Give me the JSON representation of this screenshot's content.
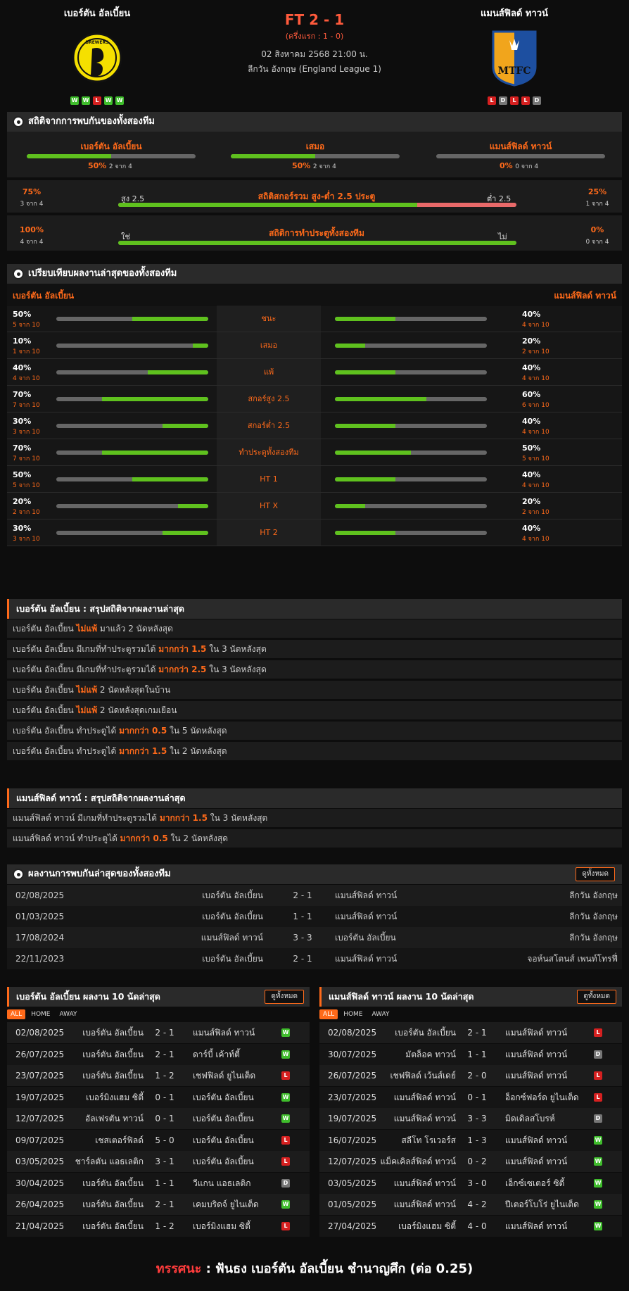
{
  "match": {
    "home": "เบอร์ตัน อัลเบี้ยน",
    "away": "แมนส์ฟิลด์ ทาวน์",
    "score": "FT 2 - 1",
    "halftime": "(ครึ่งแรก : 1 - 0)",
    "datetime": "02 สิงหาคม 2568 21:00 น.",
    "league": "ลีกวัน อังกฤษ (England League 1)",
    "home_form": [
      "W",
      "W",
      "L",
      "W",
      "W"
    ],
    "away_form": [
      "L",
      "D",
      "L",
      "L",
      "D"
    ],
    "home_logo_text": "BREWERS",
    "away_logo_text": "MTFC"
  },
  "h2h_stats": {
    "title": "สถิติจากการพบกันของทั้งสองทีม",
    "home": {
      "label": "เบอร์ตัน อัลเบี้ยน",
      "pct": "50%",
      "of": "2 จาก 4",
      "value": 0.5
    },
    "draw": {
      "label": "เสมอ",
      "pct": "50%",
      "of": "2 จาก 4",
      "value": 0.5
    },
    "away": {
      "label": "แมนส์ฟิลด์ ทาวน์",
      "pct": "0%",
      "of": "0 จาก 4",
      "value": 0
    },
    "ou": {
      "title": "สถิติสกอร์รวม สูง-ต่ำ 2.5 ประตู",
      "left_pct": "75%",
      "left_of": "3 จาก 4",
      "right_pct": "25%",
      "right_of": "1 จาก 4",
      "left_label": "สูง 2.5",
      "right_label": "ต่ำ 2.5",
      "value": 0.75
    },
    "btts": {
      "title": "สถิติการทำประตูทั้งสองทีม",
      "left_pct": "100%",
      "left_of": "4 จาก 4",
      "right_pct": "0%",
      "right_of": "0 จาก 4",
      "left_label": "ใช่",
      "right_label": "ไม่",
      "value": 1.0
    }
  },
  "compare": {
    "title": "เปรียบเทียบผลงานล่าสุดของทั้งสองทีม",
    "home": "เบอร์ตัน อัลเบี้ยน",
    "away": "แมนส์ฟิลด์ ทาวน์",
    "rows": [
      {
        "label": "ชนะ",
        "hp": "50%",
        "hc": "5 จาก 10",
        "hv": 0.5,
        "ap": "40%",
        "ac": "4 จาก 10",
        "av": 0.4
      },
      {
        "label": "เสมอ",
        "hp": "10%",
        "hc": "1 จาก 10",
        "hv": 0.1,
        "ap": "20%",
        "ac": "2 จาก 10",
        "av": 0.2
      },
      {
        "label": "แพ้",
        "hp": "40%",
        "hc": "4 จาก 10",
        "hv": 0.4,
        "ap": "40%",
        "ac": "4 จาก 10",
        "av": 0.4
      },
      {
        "label": "สกอร์สูง 2.5",
        "hp": "70%",
        "hc": "7 จาก 10",
        "hv": 0.7,
        "ap": "60%",
        "ac": "6 จาก 10",
        "av": 0.6
      },
      {
        "label": "สกอร์ต่ำ 2.5",
        "hp": "30%",
        "hc": "3 จาก 10",
        "hv": 0.3,
        "ap": "40%",
        "ac": "4 จาก 10",
        "av": 0.4
      },
      {
        "label": "ทำประตูทั้งสองทีม",
        "hp": "70%",
        "hc": "7 จาก 10",
        "hv": 0.7,
        "ap": "50%",
        "ac": "5 จาก 10",
        "av": 0.5
      },
      {
        "label": "HT 1",
        "hp": "50%",
        "hc": "5 จาก 10",
        "hv": 0.5,
        "ap": "40%",
        "ac": "4 จาก 10",
        "av": 0.4
      },
      {
        "label": "HT X",
        "hp": "20%",
        "hc": "2 จาก 10",
        "hv": 0.2,
        "ap": "20%",
        "ac": "2 จาก 10",
        "av": 0.2
      },
      {
        "label": "HT 2",
        "hp": "30%",
        "hc": "3 จาก 10",
        "hv": 0.3,
        "ap": "40%",
        "ac": "4 จาก 10",
        "av": 0.4
      }
    ]
  },
  "home_summary": {
    "title": "เบอร์ตัน อัลเบี้ยน : สรุปสถิติจากผลงานล่าสุด",
    "rows": [
      [
        "เบอร์ตัน อัลเบี้ยน ",
        "ไม่แพ้",
        " มาแล้ว 2 นัดหลังสุด"
      ],
      [
        "เบอร์ตัน อัลเบี้ยน มีเกมที่ทำประตูรวมได้ ",
        "มากกว่า 1.5",
        " ใน 3 นัดหลังสุด"
      ],
      [
        "เบอร์ตัน อัลเบี้ยน มีเกมที่ทำประตูรวมได้ ",
        "มากกว่า 2.5",
        " ใน 3 นัดหลังสุด"
      ],
      [
        "เบอร์ตัน อัลเบี้ยน ",
        "ไม่แพ้",
        " 2 นัดหลังสุดในบ้าน"
      ],
      [
        "เบอร์ตัน อัลเบี้ยน ",
        "ไม่แพ้",
        " 2 นัดหลังสุดเกมเยือน"
      ],
      [
        "เบอร์ตัน อัลเบี้ยน ทำประตูได้ ",
        "มากกว่า 0.5",
        " ใน 5 นัดหลังสุด"
      ],
      [
        "เบอร์ตัน อัลเบี้ยน ทำประตูได้ ",
        "มากกว่า 1.5",
        " ใน 2 นัดหลังสุด"
      ]
    ]
  },
  "away_summary": {
    "title": "แมนส์ฟิลด์ ทาวน์ : สรุปสถิติจากผลงานล่าสุด",
    "rows": [
      [
        "แมนส์ฟิลด์ ทาวน์ มีเกมที่ทำประตูรวมได้ ",
        "มากกว่า 1.5",
        " ใน 3 นัดหลังสุด"
      ],
      [
        "แมนส์ฟิลด์ ทาวน์ ทำประตูได้ ",
        "มากกว่า 0.5",
        " ใน 2 นัดหลังสุด"
      ]
    ]
  },
  "h2h": {
    "title": "ผลงานการพบกันล่าสุดของทั้งสองทีม",
    "view_all": "ดูทั้งหมด",
    "rows": [
      [
        "02/08/2025",
        "เบอร์ตัน อัลเบี้ยน",
        "2 - 1",
        "แมนส์ฟิลด์ ทาวน์",
        "ลีกวัน อังกฤษ"
      ],
      [
        "01/03/2025",
        "เบอร์ตัน อัลเบี้ยน",
        "1 - 1",
        "แมนส์ฟิลด์ ทาวน์",
        "ลีกวัน อังกฤษ"
      ],
      [
        "17/08/2024",
        "แมนส์ฟิลด์ ทาวน์",
        "3 - 3",
        "เบอร์ตัน อัลเบี้ยน",
        "ลีกวัน อังกฤษ"
      ],
      [
        "22/11/2023",
        "เบอร์ตัน อัลเบี้ยน",
        "2 - 1",
        "แมนส์ฟิลด์ ทาวน์",
        "จอห์นสโตนส์ เพนท์โทรฟี่"
      ]
    ]
  },
  "home_last10": {
    "title": "เบอร์ตัน อัลเบี้ยน ผลงาน 10 นัดล่าสุด",
    "view_all": "ดูทั้งหมด",
    "tabs": [
      "ALL",
      "HOME",
      "AWAY"
    ],
    "rows": [
      [
        "02/08/2025",
        "เบอร์ตัน อัลเบี้ยน",
        "2 - 1",
        "แมนส์ฟิลด์ ทาวน์",
        "W"
      ],
      [
        "26/07/2025",
        "เบอร์ตัน อัลเบี้ยน",
        "2 - 1",
        "ดาร์บี้ เค้าท์ตี้",
        "W"
      ],
      [
        "23/07/2025",
        "เบอร์ตัน อัลเบี้ยน",
        "1 - 2",
        "เชฟฟิลด์ ยูไนเต็ด",
        "L"
      ],
      [
        "19/07/2025",
        "เบอร์มิงแฮม ซิตี้",
        "0 - 1",
        "เบอร์ตัน อัลเบี้ยน",
        "W"
      ],
      [
        "12/07/2025",
        "อัลเฟรตัน ทาวน์",
        "0 - 1",
        "เบอร์ตัน อัลเบี้ยน",
        "W"
      ],
      [
        "09/07/2025",
        "เชสเตอร์ฟิลด์",
        "5 - 0",
        "เบอร์ตัน อัลเบี้ยน",
        "L"
      ],
      [
        "03/05/2025",
        "ชาร์ลตัน แอธเลติก",
        "3 - 1",
        "เบอร์ตัน อัลเบี้ยน",
        "L"
      ],
      [
        "30/04/2025",
        "เบอร์ตัน อัลเบี้ยน",
        "1 - 1",
        "วีแกน แอธเลติก",
        "D"
      ],
      [
        "26/04/2025",
        "เบอร์ตัน อัลเบี้ยน",
        "2 - 1",
        "เคมบริดจ์ ยูไนเต็ด",
        "W"
      ],
      [
        "21/04/2025",
        "เบอร์ตัน อัลเบี้ยน",
        "1 - 2",
        "เบอร์มิงแฮม ซิตี้",
        "L"
      ]
    ]
  },
  "away_last10": {
    "title": "แมนส์ฟิลด์ ทาวน์ ผลงาน 10 นัดล่าสุด",
    "view_all": "ดูทั้งหมด",
    "tabs": [
      "ALL",
      "HOME",
      "AWAY"
    ],
    "rows": [
      [
        "02/08/2025",
        "เบอร์ตัน อัลเบี้ยน",
        "2 - 1",
        "แมนส์ฟิลด์ ทาวน์",
        "L"
      ],
      [
        "30/07/2025",
        "มัตล็อค ทาวน์",
        "1 - 1",
        "แมนส์ฟิลด์ ทาวน์",
        "D"
      ],
      [
        "26/07/2025",
        "เชฟฟิลด์ เว้นส์เดย์",
        "2 - 0",
        "แมนส์ฟิลด์ ทาวน์",
        "L"
      ],
      [
        "23/07/2025",
        "แมนส์ฟิลด์ ทาวน์",
        "0 - 1",
        "อ็อกซ์ฟอร์ด ยูไนเต็ด",
        "L"
      ],
      [
        "19/07/2025",
        "แมนส์ฟิลด์ ทาวน์",
        "3 - 3",
        "มิดเดิลสโบรห์",
        "D"
      ],
      [
        "16/07/2025",
        "สลีโท โรเวอร์ส",
        "1 - 3",
        "แมนส์ฟิลด์ ทาวน์",
        "W"
      ],
      [
        "12/07/2025",
        "แม็คเคิลส์ฟิลด์ ทาวน์",
        "0 - 2",
        "แมนส์ฟิลด์ ทาวน์",
        "W"
      ],
      [
        "03/05/2025",
        "แมนส์ฟิลด์ ทาวน์",
        "3 - 0",
        "เอ็กซ์เซเตอร์ ซิตี้",
        "W"
      ],
      [
        "01/05/2025",
        "แมนส์ฟิลด์ ทาวน์",
        "4 - 2",
        "ปีเตอร์โบโร่ ยูไนเต็ด",
        "W"
      ],
      [
        "27/04/2025",
        "เบอร์มิงแฮม ซิตี้",
        "4 - 0",
        "แมนส์ฟิลด์ ทาวน์",
        "W"
      ]
    ]
  },
  "prediction": {
    "label": "ทรรศนะ",
    "sep": " : ",
    "text": " ฟันธง เบอร์ตัน อัลเบี้ยน ชำนาญศึก (ต่อ 0.25)"
  },
  "colors": {
    "accent": "#ff6a1a",
    "win": "#3fbd2c",
    "loss": "#d62020",
    "draw": "#777777",
    "bar_fill": "#5fc11e",
    "bar_under": "#e96a6a"
  }
}
